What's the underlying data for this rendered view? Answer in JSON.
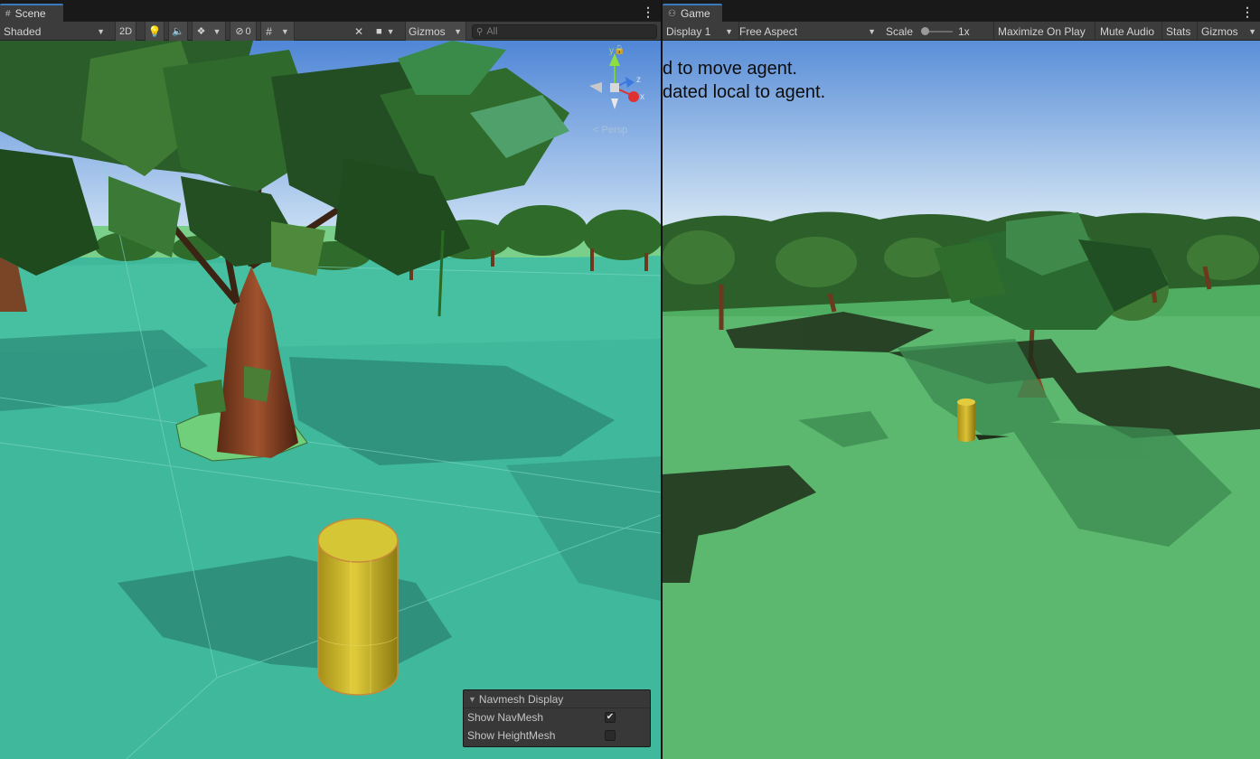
{
  "scene": {
    "tab_label": "Scene",
    "tab_icon": "scene-grid-icon",
    "shading_mode": "Shaded",
    "mode_2d": "2D",
    "hidden_count": "0",
    "gizmos_label": "Gizmos",
    "search_placeholder": "All",
    "persp_label": "Persp",
    "axis": {
      "y": "y",
      "z": "z",
      "x": "x"
    },
    "icons": [
      "lighting-icon",
      "audio-icon",
      "effects-icon",
      "visibility-icon",
      "grid-icon",
      "tools-icon",
      "camera-icon",
      "search-icon",
      "lock-icon",
      "kebab-menu-icon"
    ]
  },
  "navmesh_overlay": {
    "title": "Navmesh Display",
    "rows": [
      {
        "label": "Show NavMesh",
        "checked": true
      },
      {
        "label": "Show HeightMesh",
        "checked": false
      }
    ]
  },
  "game": {
    "tab_label": "Game",
    "tab_icon": "gamepad-icon",
    "display": "Display 1",
    "aspect": "Free Aspect",
    "scale_label": "Scale",
    "scale_value": "1x",
    "scale_level": 0,
    "maximize_on_play": "Maximize On Play",
    "mute_audio": "Mute Audio",
    "stats": "Stats",
    "gizmos": "Gizmos",
    "overlay_lines": [
      "d to move agent.",
      "dated local to agent."
    ]
  },
  "colors": {
    "accent": "#3a79bb",
    "toolbar": "#3c3c3c",
    "navmesh": "#3fbf9f",
    "ground": "#5cb86e",
    "sky_top": "#5a8ed8",
    "agent": "#d8c23a"
  }
}
